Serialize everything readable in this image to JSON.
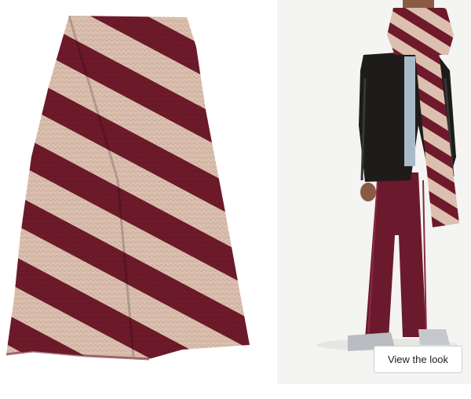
{
  "gallery": {
    "product_image": {
      "subject": "scarf-product-photo",
      "stripe_colors": {
        "burgundy": "#6e1a2a",
        "beige": "#dcbfae"
      }
    },
    "model_image": {
      "subject": "model-wearing-scarf-photo",
      "colors": {
        "background": "#f4f4f2",
        "jacket": "#1e1b1b",
        "trousers": "#6b1a2d",
        "shirt": "#a9b9c9"
      }
    },
    "view_look_button": {
      "label": "View the look"
    }
  }
}
